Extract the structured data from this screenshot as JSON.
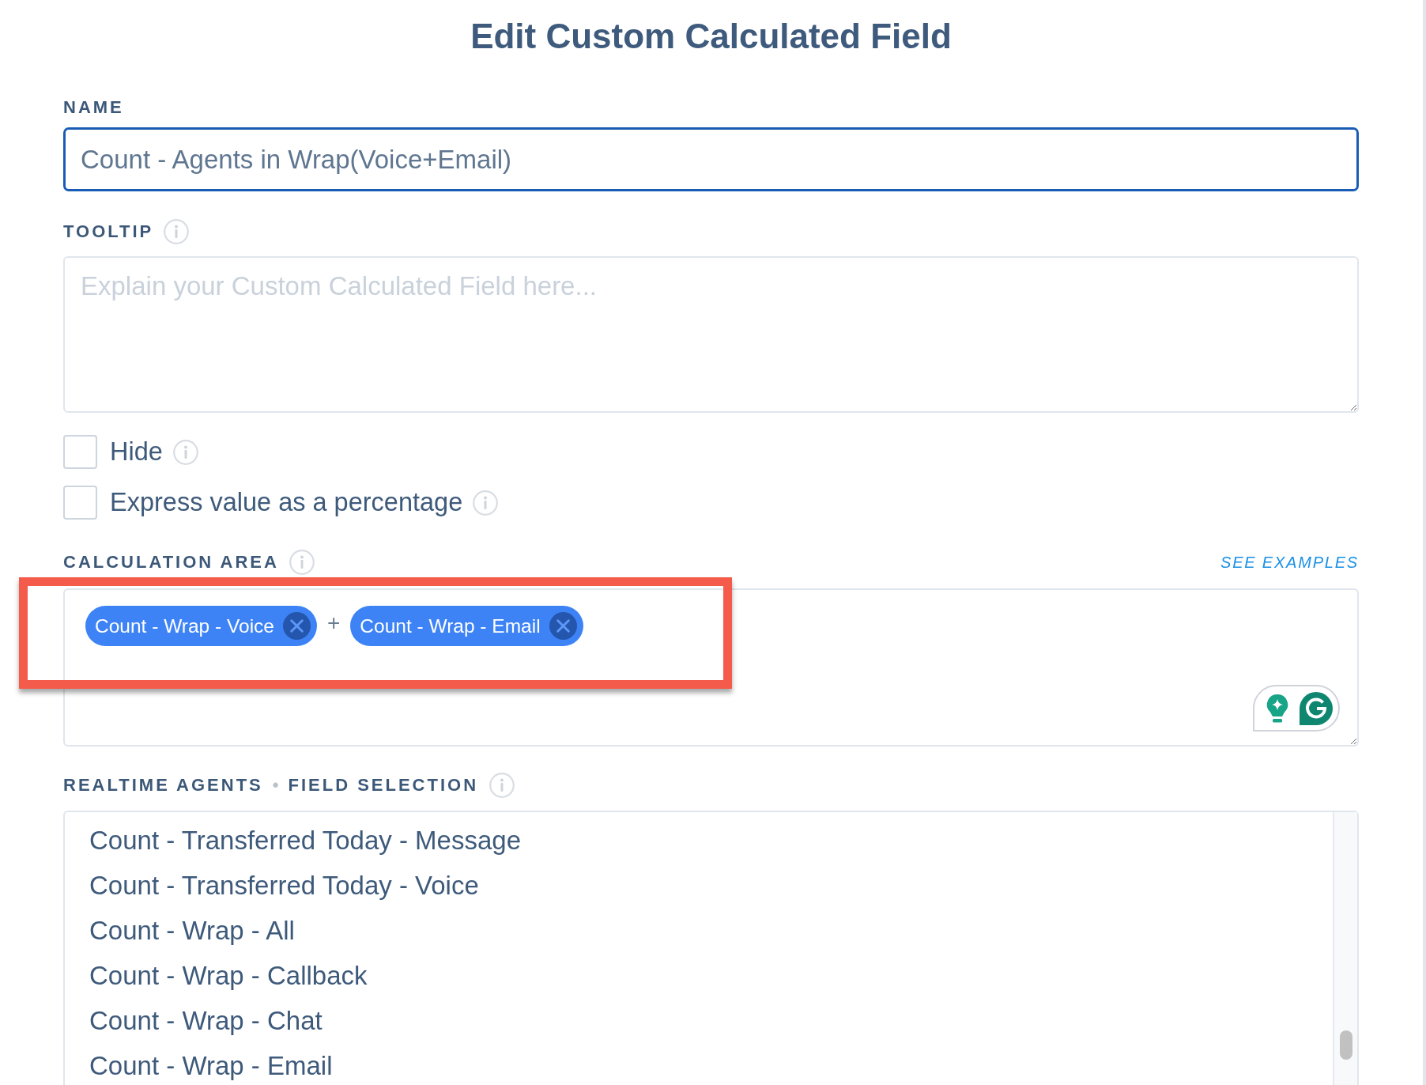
{
  "title": "Edit Custom Calculated Field",
  "name_field": {
    "label": "NAME",
    "value": "Count - Agents in Wrap(Voice+Email)",
    "focused": true
  },
  "tooltip_field": {
    "label": "TOOLTIP",
    "info": true,
    "placeholder": "Explain your Custom Calculated Field here..."
  },
  "options": [
    {
      "label": "Hide",
      "checked": false,
      "info": true
    },
    {
      "label": "Express value as a percentage",
      "checked": false,
      "info": true
    }
  ],
  "calculation_area": {
    "label": "CALCULATION AREA",
    "info": true,
    "link": "SEE EXAMPLES",
    "tokens": [
      {
        "kind": "field",
        "label": "Count - Wrap - Voice"
      },
      {
        "kind": "operator",
        "label": "+"
      },
      {
        "kind": "field",
        "label": "Count - Wrap - Email"
      }
    ],
    "annotation": {
      "kind": "outline"
    }
  },
  "field_selection": {
    "category": "REALTIME AGENTS",
    "separator": "•",
    "label": "FIELD SELECTION",
    "info": true,
    "items": [
      {
        "label": "Count - Transferred Today - Message",
        "selected": false
      },
      {
        "label": "Count - Transferred Today - Voice",
        "selected": false
      },
      {
        "label": "Count - Wrap - All",
        "selected": false
      },
      {
        "label": "Count - Wrap - Callback",
        "selected": false
      },
      {
        "label": "Count - Wrap - Chat",
        "selected": false
      },
      {
        "label": "Count - Wrap - Email",
        "selected": false
      }
    ]
  }
}
